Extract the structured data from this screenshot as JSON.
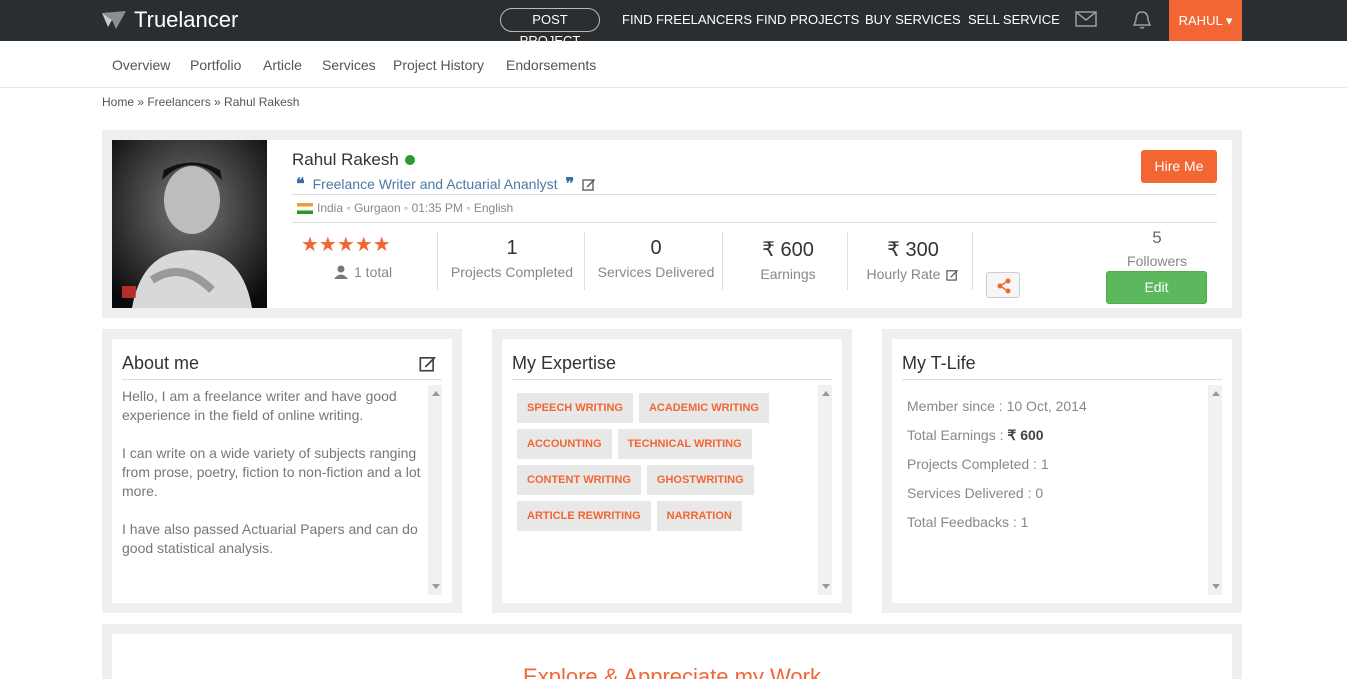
{
  "topbar": {
    "brand": "Truelancer",
    "post_project": "POST PROJECT",
    "links": [
      "FIND FREELANCERS",
      "FIND PROJECTS",
      "BUY SERVICES",
      "SELL SERVICE"
    ],
    "user": "RAHUL ▾",
    "accent": "#f26633"
  },
  "subnav": [
    "Overview",
    "Portfolio",
    "Article",
    "Services",
    "Project History",
    "Endorsements"
  ],
  "breadcrumb": "Home » Freelancers » Rahul Rakesh",
  "profile": {
    "name": "Rahul Rakesh",
    "tagline": "Freelance Writer and Actuarial Ananlyst",
    "meta": "India ◦ Gurgaon ◦ 01:35 PM ◦ English",
    "stars": "★★★★★",
    "rating_total": "1 total",
    "stats": [
      {
        "value": "1",
        "label": "Projects Completed"
      },
      {
        "value": "0",
        "label": "Services Delivered"
      },
      {
        "value": "₹ 600",
        "label": "Earnings"
      },
      {
        "value": "₹ 300",
        "label": "Hourly Rate"
      }
    ],
    "followers_count": "5",
    "followers_label": "Followers",
    "edit_label": "Edit",
    "hire_label": "Hire Me"
  },
  "about": {
    "title": "About me",
    "paragraphs": [
      "Hello, I am a freelance writer and have good experience in the field of online writing.",
      "I can write on a wide variety of subjects ranging from prose, poetry, fiction to non-fiction and a lot more.",
      "I have also passed Actuarial Papers and can do good statistical analysis."
    ]
  },
  "expertise": {
    "title": "My Expertise",
    "tags": [
      "SPEECH WRITING",
      "ACADEMIC WRITING",
      "ACCOUNTING",
      "TECHNICAL WRITING",
      "CONTENT WRITING",
      "GHOSTWRITING",
      "ARTICLE REWRITING",
      "NARRATION"
    ]
  },
  "tlife": {
    "title": "My T-Life",
    "member_since": "Member since : 10 Oct, 2014",
    "earnings_label": "Total Earnings : ",
    "earnings_value": "₹ 600",
    "projects": "Projects Completed : 1",
    "services": "Services Delivered : 0",
    "feedbacks": "Total Feedbacks : 1"
  },
  "explore": "Explore & Appreciate my Work"
}
